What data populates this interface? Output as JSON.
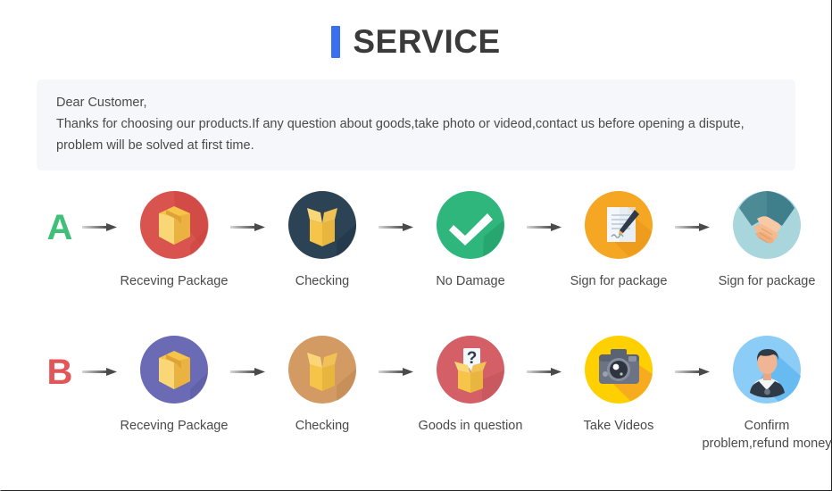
{
  "header": {
    "title": "SERVICE",
    "accent_color": "#3a6ff0",
    "title_color": "#3a3a3a"
  },
  "notice": {
    "line1": "Dear Customer,",
    "line2": "Thanks for choosing our products.If any question about goods,take photo or videod,contact us before opening a dispute,",
    "line3": "problem will be solved at first time.",
    "background_color": "#f6f7fa"
  },
  "flows": [
    {
      "letter": "A",
      "letter_color": "#3fbf77",
      "steps": [
        {
          "label": "Receving Package",
          "icon": "closed-box-icon",
          "circle_color": "#d9534f"
        },
        {
          "label": "Checking",
          "icon": "open-box-icon",
          "circle_color": "#2c4356"
        },
        {
          "label": "No Damage",
          "icon": "checkmark-icon",
          "circle_color": "#2eb67d"
        },
        {
          "label": "Sign for package",
          "icon": "document-pen-icon",
          "circle_color": "#f5a623"
        },
        {
          "label": "Sign for package",
          "icon": "handshake-icon",
          "circle_color": "#a9d5dd"
        }
      ]
    },
    {
      "letter": "B",
      "letter_color": "#e2565a",
      "steps": [
        {
          "label": "Receving Package",
          "icon": "closed-box-icon",
          "circle_color": "#6a6ab5"
        },
        {
          "label": "Checking",
          "icon": "open-box-icon",
          "circle_color": "#d39a63"
        },
        {
          "label": "Goods in question",
          "icon": "question-box-icon",
          "circle_color": "#d45f67"
        },
        {
          "label": "Take Videos",
          "icon": "camera-icon",
          "circle_color": "#ffd000"
        },
        {
          "label": "Confirm problem,refund money",
          "icon": "support-person-icon",
          "circle_color": "#8ccdf7"
        }
      ]
    }
  ],
  "arrow": {
    "name": "right-arrow-icon",
    "color_light": "#cfcfcf",
    "color_dark": "#4a4a4a"
  }
}
